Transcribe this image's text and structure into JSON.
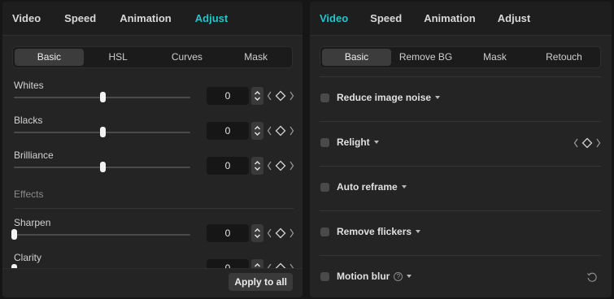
{
  "left": {
    "tabs": [
      {
        "label": "Video",
        "active": false
      },
      {
        "label": "Speed",
        "active": false
      },
      {
        "label": "Animation",
        "active": false
      },
      {
        "label": "Adjust",
        "active": true
      }
    ],
    "subtabs": [
      {
        "label": "Basic",
        "active": true
      },
      {
        "label": "HSL",
        "active": false
      },
      {
        "label": "Curves",
        "active": false
      },
      {
        "label": "Mask",
        "active": false
      }
    ],
    "params": [
      {
        "label": "Whites",
        "value": "0",
        "level": 0.5
      },
      {
        "label": "Blacks",
        "value": "0",
        "level": 0.5
      },
      {
        "label": "Brilliance",
        "value": "0",
        "level": 0.5
      }
    ],
    "effects_label": "Effects",
    "effects": [
      {
        "label": "Sharpen",
        "value": "0",
        "level": 0.0
      },
      {
        "label": "Clarity",
        "value": "0",
        "level": 0.0
      }
    ],
    "apply_all": "Apply to all"
  },
  "right": {
    "tabs": [
      {
        "label": "Video",
        "active": true
      },
      {
        "label": "Speed",
        "active": false
      },
      {
        "label": "Animation",
        "active": false
      },
      {
        "label": "Adjust",
        "active": false
      }
    ],
    "subtabs": [
      {
        "label": "Basic",
        "active": true
      },
      {
        "label": "Remove BG",
        "active": false
      },
      {
        "label": "Mask",
        "active": false
      },
      {
        "label": "Retouch",
        "active": false
      }
    ],
    "options": [
      {
        "label": "Reduce image noise",
        "checked": false,
        "keyframe": false,
        "help": false,
        "reset": false
      },
      {
        "label": "Relight",
        "checked": false,
        "keyframe": true,
        "help": false,
        "reset": false
      },
      {
        "label": "Auto reframe",
        "checked": false,
        "keyframe": false,
        "help": false,
        "reset": false
      },
      {
        "label": "Remove flickers",
        "checked": false,
        "keyframe": false,
        "help": false,
        "reset": false
      },
      {
        "label": "Motion blur",
        "checked": false,
        "keyframe": false,
        "help": true,
        "reset": true
      }
    ]
  },
  "colors": {
    "accent": "#23c6cf",
    "panel_bg": "#242424",
    "nav_bg": "#1e1e1e",
    "text": "#d6d6d6"
  },
  "icons": [
    "stepper-icon",
    "keyframe-diamond-icon",
    "chevron-left-icon",
    "chevron-right-icon",
    "dropdown-caret-icon",
    "help-icon",
    "reset-icon"
  ]
}
